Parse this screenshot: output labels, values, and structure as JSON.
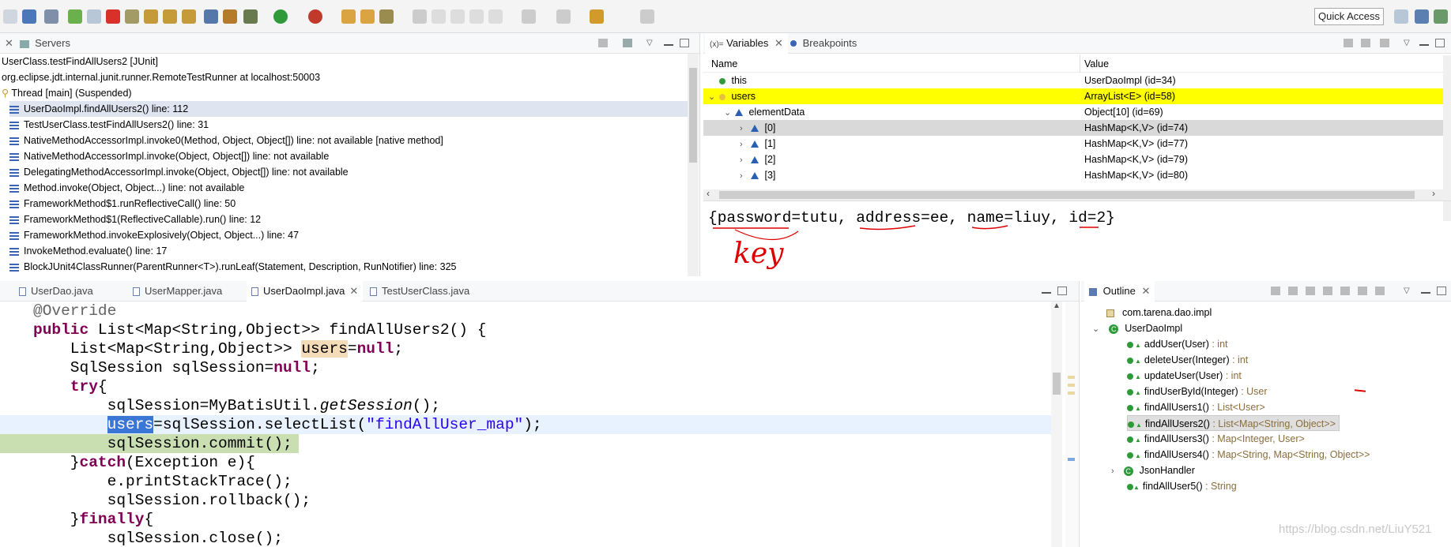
{
  "toolbar": {
    "quick_access": "Quick Access"
  },
  "servers_panel": {
    "tab_label": "Servers"
  },
  "debug": {
    "launch": "UserClass.testFindAllUsers2 [JUnit]",
    "runner": "org.eclipse.jdt.internal.junit.runner.RemoteTestRunner at localhost:50003",
    "thread": "Thread [main] (Suspended)",
    "frames": [
      "UserDaoImpl.findAllUsers2() line: 112",
      "TestUserClass.testFindAllUsers2() line: 31",
      "NativeMethodAccessorImpl.invoke0(Method, Object, Object[]) line: not available [native method]",
      "NativeMethodAccessorImpl.invoke(Object, Object[]) line: not available",
      "DelegatingMethodAccessorImpl.invoke(Object, Object[]) line: not available",
      "Method.invoke(Object, Object...) line: not available",
      "FrameworkMethod$1.runReflectiveCall() line: 50",
      "FrameworkMethod$1(ReflectiveCallable).run() line: 12",
      "FrameworkMethod.invokeExplosively(Object, Object...) line: 47",
      "InvokeMethod.evaluate() line: 17",
      "BlockJUnit4ClassRunner(ParentRunner<T>).runLeaf(Statement, Description, RunNotifier) line: 325"
    ]
  },
  "variables": {
    "tab_label": "Variables",
    "tab_prefix": "(x)=",
    "breakpoints_label": "Breakpoints",
    "col_name": "Name",
    "col_value": "Value",
    "rows": [
      {
        "name": "this",
        "value": "UserDaoImpl  (id=34)"
      },
      {
        "name": "users",
        "value": "ArrayList<E>  (id=58)"
      },
      {
        "name": "elementData",
        "value": "Object[10]  (id=69)"
      },
      {
        "name": "[0]",
        "value": "HashMap<K,V>  (id=74)"
      },
      {
        "name": "[1]",
        "value": "HashMap<K,V>  (id=77)"
      },
      {
        "name": "[2]",
        "value": "HashMap<K,V>  (id=79)"
      },
      {
        "name": "[3]",
        "value": "HashMap<K,V>  (id=80)"
      }
    ],
    "detail": "{password=tutu, address=ee, name=liuy, id=2}",
    "handwritten_note": "key"
  },
  "editor": {
    "tabs": [
      "UserDao.java",
      "UserMapper.java",
      "UserDaoImpl.java",
      "TestUserClass.java"
    ],
    "active_tab": 2
  },
  "outline": {
    "tab_label": "Outline",
    "package": "com.tarena.dao.impl",
    "class": "UserDaoImpl",
    "members": [
      {
        "name": "addUser(User)",
        "ret": " : int"
      },
      {
        "name": "deleteUser(Integer)",
        "ret": " : int"
      },
      {
        "name": "updateUser(User)",
        "ret": " : int"
      },
      {
        "name": "findUserById(Integer)",
        "ret": " : User"
      },
      {
        "name": "findAllUsers1()",
        "ret": " : List<User>"
      },
      {
        "name": "findAllUsers2()",
        "ret": " : List<Map<String, Object>>"
      },
      {
        "name": "findAllUsers3()",
        "ret": " : Map<Integer, User>"
      },
      {
        "name": "findAllUsers4()",
        "ret": " : Map<String, Map<String, Object>>"
      }
    ],
    "inner_class": "JsonHandler",
    "last_member": {
      "name": "findAllUser5()",
      "ret": " : String"
    }
  },
  "watermark": "https://blog.csdn.net/LiuY521",
  "colors": {
    "highlight_yellow": "#ffff00",
    "selected_row": "#dfe5f0",
    "current_line": "#c9dfb1",
    "keyword": "#7f0055"
  }
}
